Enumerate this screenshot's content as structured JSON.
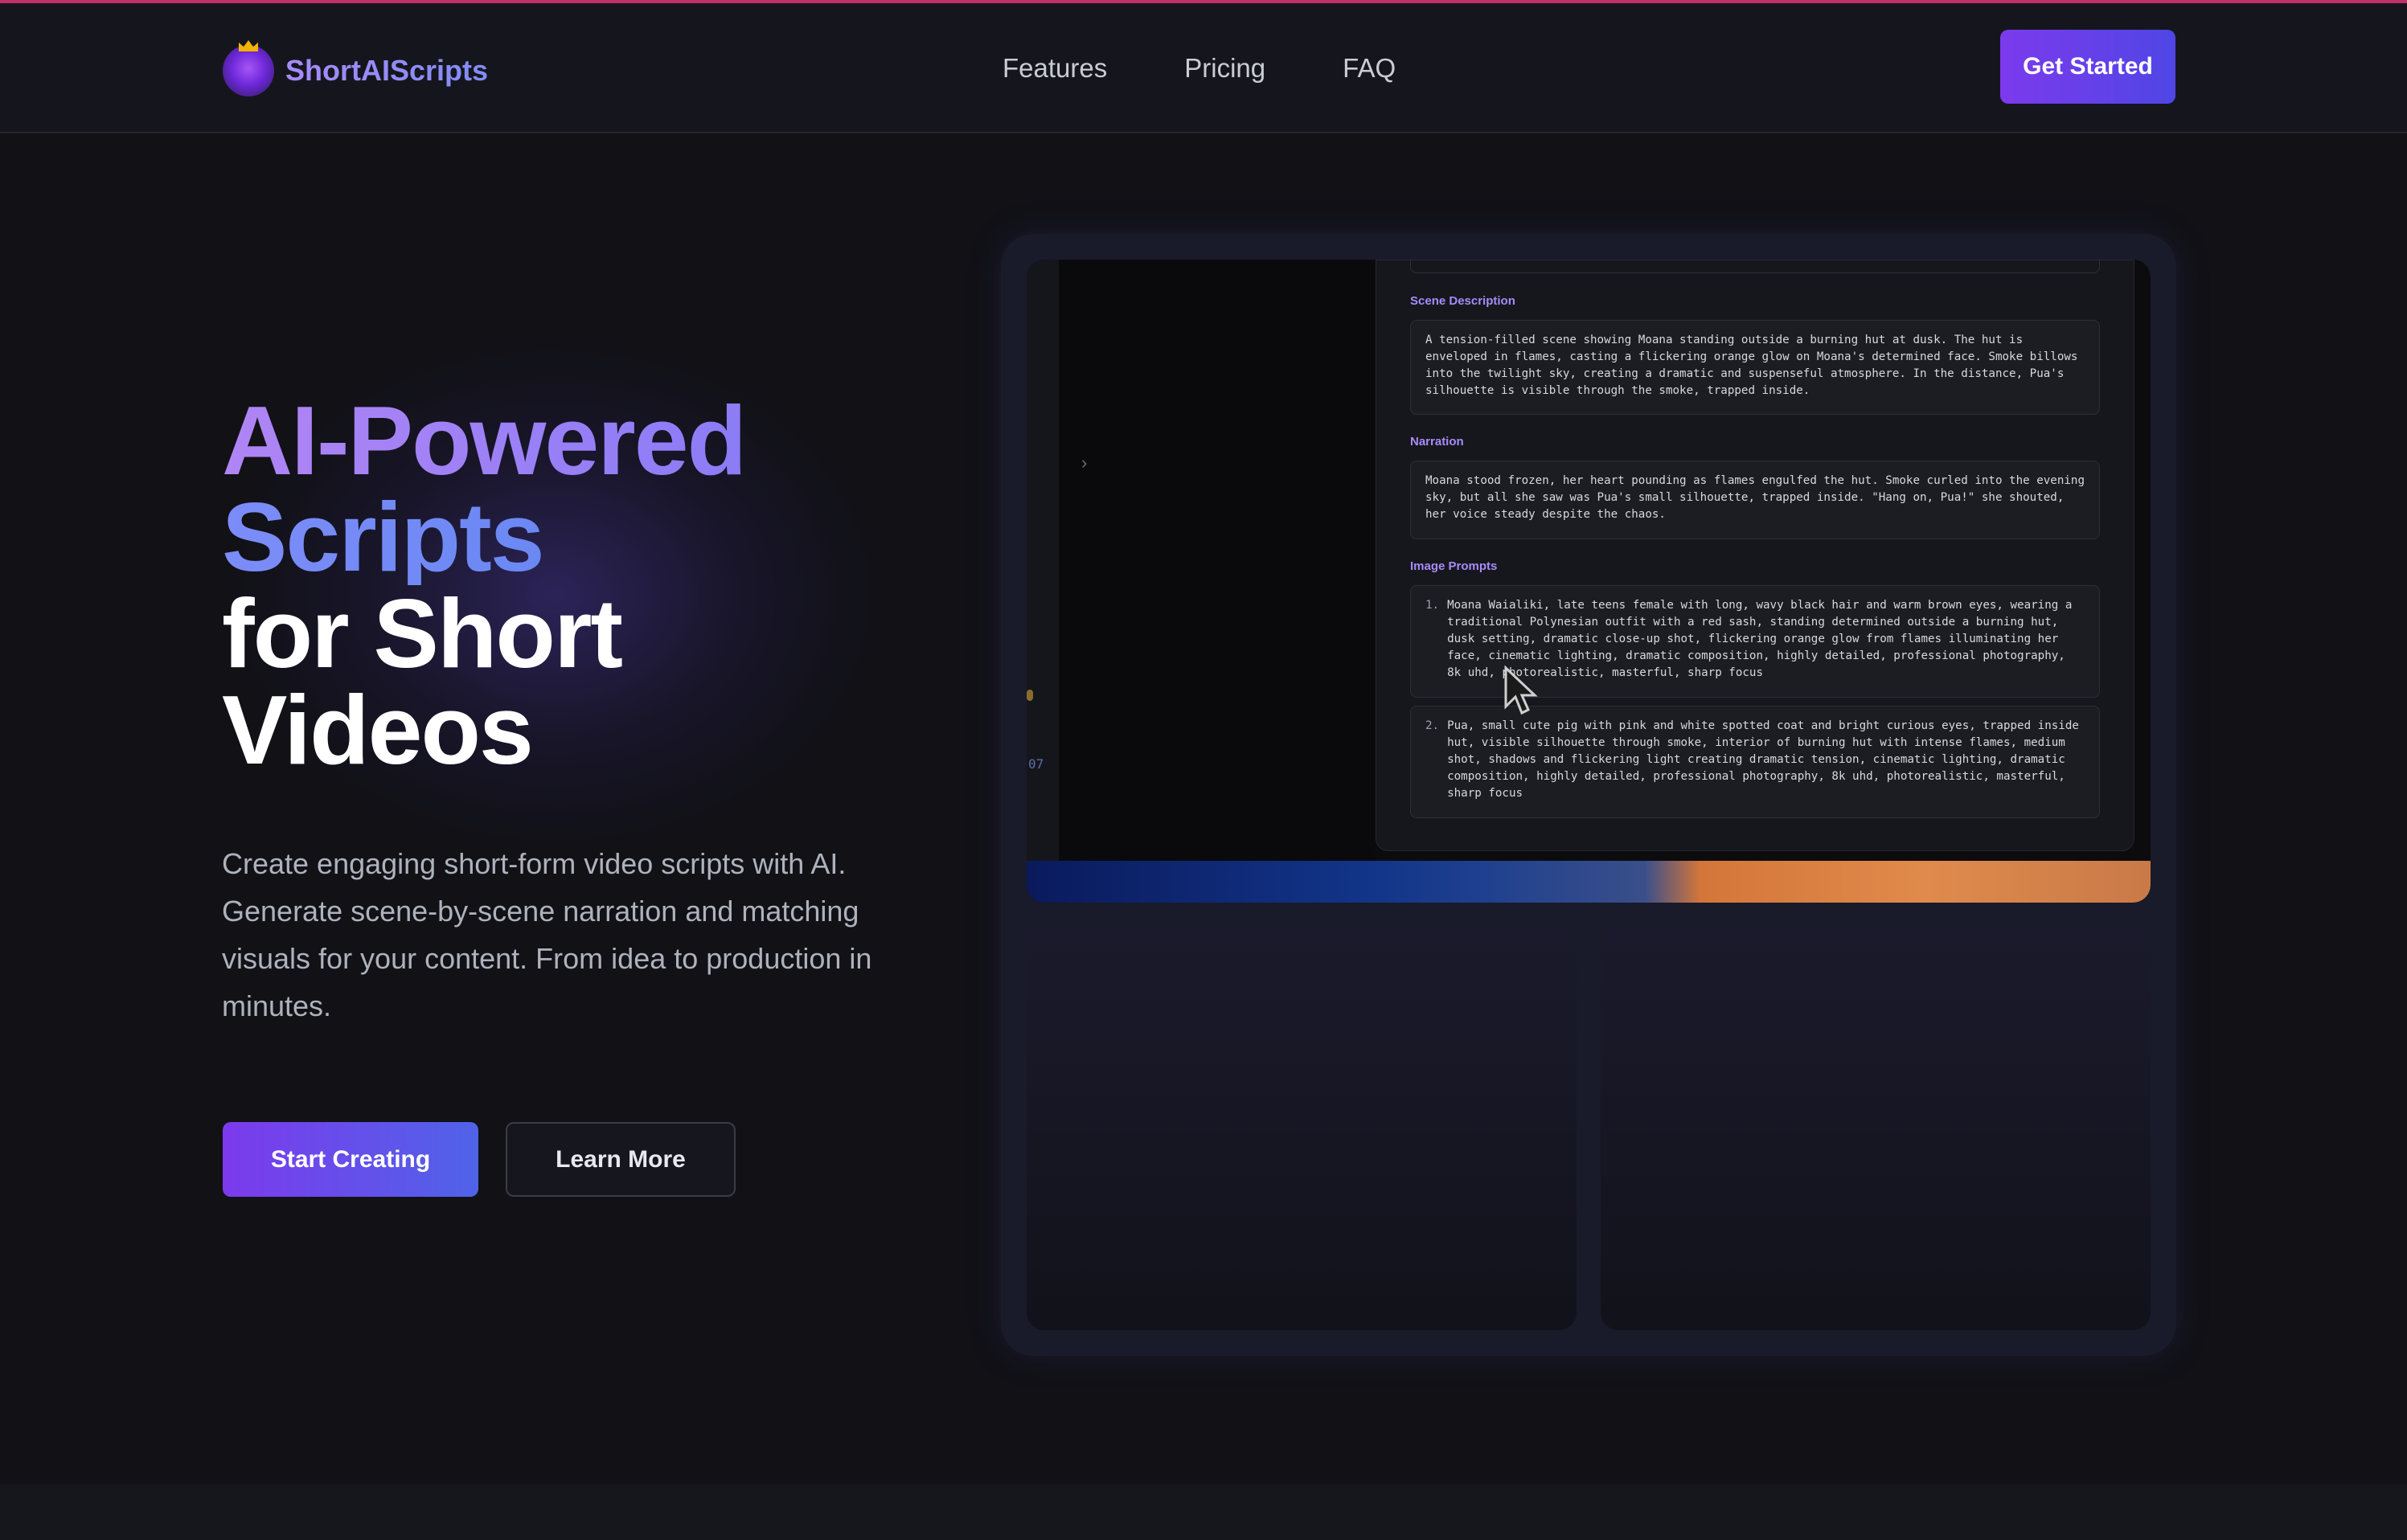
{
  "brand": {
    "name": "ShortAIScripts",
    "logo_icon": "lion-crown-icon"
  },
  "nav": {
    "links": [
      "Features",
      "Pricing",
      "FAQ"
    ],
    "cta_label": "Get Started"
  },
  "hero": {
    "title_line1": "AI-Powered",
    "title_line2": "Scripts",
    "title_line3": "for Short",
    "title_line4": "Videos",
    "subtitle": "Create engaging short-form video scripts with AI. Generate scene-by-scene narration and matching visuals for your content. From idea to production in minutes.",
    "primary_button": "Start Creating",
    "secondary_button": "Learn More"
  },
  "preview": {
    "chevron_icon": "chevron-right-icon",
    "side_number": "07",
    "scene_description_label": "Scene Description",
    "scene_description": "A tension-filled scene showing Moana standing outside a burning hut at dusk. The hut is enveloped in flames, casting a flickering orange glow on Moana's determined face. Smoke billows into the twilight sky, creating a dramatic and suspenseful atmosphere. In the distance, Pua's silhouette is visible through the smoke, trapped inside.",
    "narration_label": "Narration",
    "narration": "Moana stood frozen, her heart pounding as flames engulfed the hut. Smoke curled into the evening sky, but all she saw was Pua's small silhouette, trapped inside. \"Hang on, Pua!\" she shouted, her voice steady despite the chaos.",
    "image_prompts_label": "Image Prompts",
    "image_prompts": [
      {
        "num": "1.",
        "text": "Moana Waialiki, late teens female with long, wavy black hair and warm brown eyes, wearing a traditional Polynesian outfit with a red sash, standing determined outside a burning hut, dusk setting, dramatic close-up shot, flickering orange glow from flames illuminating her face, cinematic lighting, dramatic composition, highly detailed, professional photography, 8k uhd, photorealistic, masterful, sharp focus"
      },
      {
        "num": "2.",
        "text": "Pua, small cute pig with pink and white spotted coat and bright curious eyes, trapped inside hut, visible silhouette through smoke, interior of burning hut with intense flames, medium shot, shadows and flickering light creating dramatic tension, cinematic lighting, dramatic composition, highly detailed, professional photography, 8k uhd, photorealistic, masterful, sharp focus"
      }
    ]
  },
  "colors": {
    "accent_purple": "#7c3aed",
    "accent_indigo": "#4f46e5",
    "background": "#111116",
    "label_purple": "#a78bfa"
  }
}
